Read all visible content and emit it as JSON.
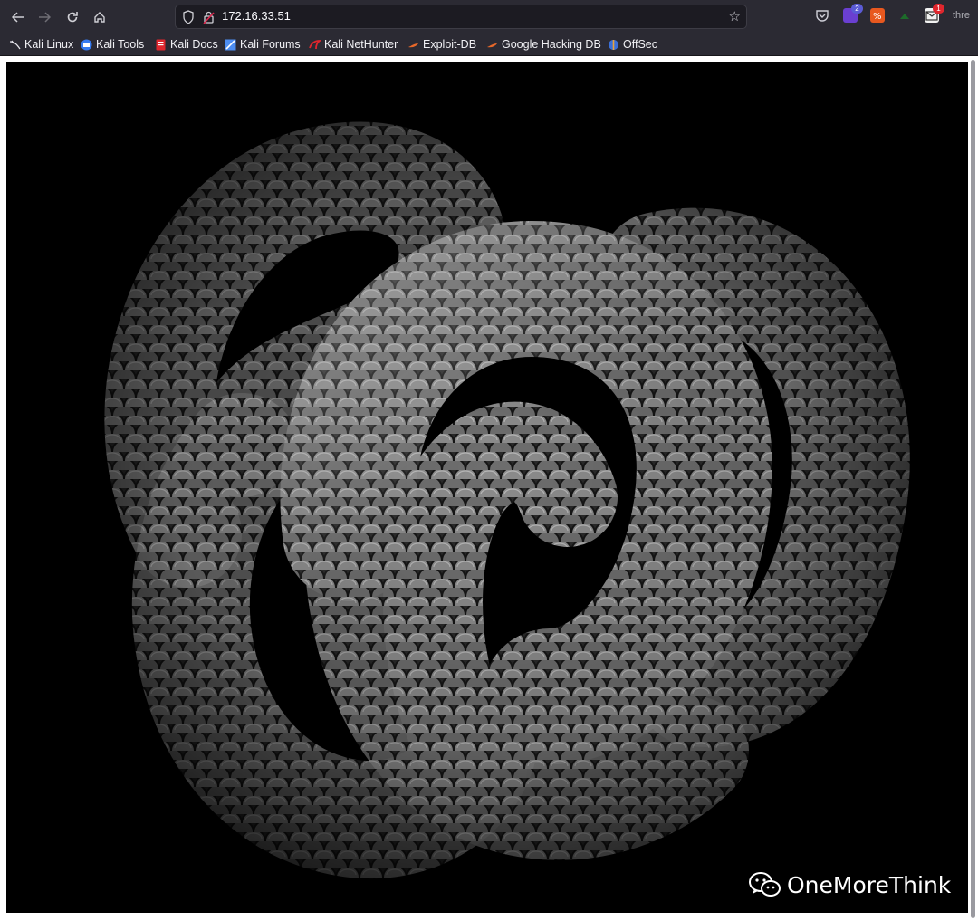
{
  "browser": {
    "url": "172.16.33.51",
    "overflow_label": "thre",
    "extension_badges": {
      "ext_purple": "2",
      "ext_mail": "1"
    }
  },
  "bookmarks": [
    {
      "label": "Kali Linux"
    },
    {
      "label": "Kali Tools"
    },
    {
      "label": "Kali Docs"
    },
    {
      "label": "Kali Forums"
    },
    {
      "label": "Kali NetHunter"
    },
    {
      "label": "Exploit-DB"
    },
    {
      "label": "Google Hacking DB"
    },
    {
      "label": "OffSec"
    }
  ],
  "page": {
    "watermark_text": "OneMoreThink"
  }
}
